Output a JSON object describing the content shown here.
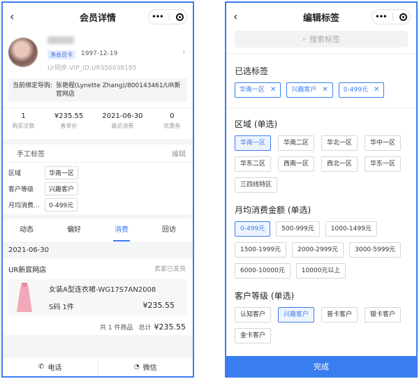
{
  "left": {
    "title": "会员详情",
    "member": {
      "badge": "渔会员卡",
      "birthday": "1997-12-19",
      "sync_id": "Ur同步-VIP_ID:URS50038195",
      "guide_label": "当前绑定导购:",
      "guide_value": "张艳程(Lynette Zhang)/800143461/UR新官网店"
    },
    "stats": [
      {
        "value": "1",
        "label": "购买次数"
      },
      {
        "value": "¥235.55",
        "label": "客单价"
      },
      {
        "value": "2021-06-30",
        "label": "最近消费"
      },
      {
        "value": "0",
        "label": "优惠券"
      }
    ],
    "manual_tags": {
      "title": "手工标签",
      "edit": "编辑",
      "rows": [
        {
          "label": "区域",
          "value": "华南一区"
        },
        {
          "label": "客户等级",
          "value": "兴趣客户"
        },
        {
          "label": "月均消费...",
          "value": "0-499元"
        }
      ]
    },
    "tabs": [
      "动态",
      "偏好",
      "消费",
      "回访"
    ],
    "active_tab": "消费",
    "order": {
      "date": "2021-06-30",
      "store": "UR新官网店",
      "status": "卖家已发货",
      "product_name": "女装A型连衣裙-WG17S7AN2008",
      "sku": "S码 1件",
      "price": "¥235.55",
      "summary_count": "共 1 件商品",
      "summary_total_label": "总计",
      "summary_total": "¥235.55"
    },
    "bottom": {
      "phone": "电话",
      "wechat": "微信"
    }
  },
  "right": {
    "title": "编辑标签",
    "search_placeholder": "搜索标签",
    "selected_title": "已选标签",
    "selected": [
      "华南一区",
      "兴趣客户",
      "0-499元"
    ],
    "region_title": "区域 (单选)",
    "regions": [
      "华南一区",
      "华南二区",
      "华北一区",
      "华中一区",
      "华东二区",
      "西南一区",
      "西北一区",
      "华东一区",
      "三四线特区"
    ],
    "region_selected": "华南一区",
    "spend_title": "月均消费金额 (单选)",
    "spends": [
      "0-499元",
      "500-999元",
      "1000-1499元",
      "1500-1999元",
      "2000-2999元",
      "3000-5999元",
      "6000-10000元",
      "10000元以上"
    ],
    "spend_selected": "0-499元",
    "level_title": "客户等级 (单选)",
    "levels": [
      "认知客户",
      "兴趣客户",
      "普卡客户",
      "银卡客户",
      "金卡客户"
    ],
    "level_selected": "兴趣客户",
    "done": "完成"
  }
}
